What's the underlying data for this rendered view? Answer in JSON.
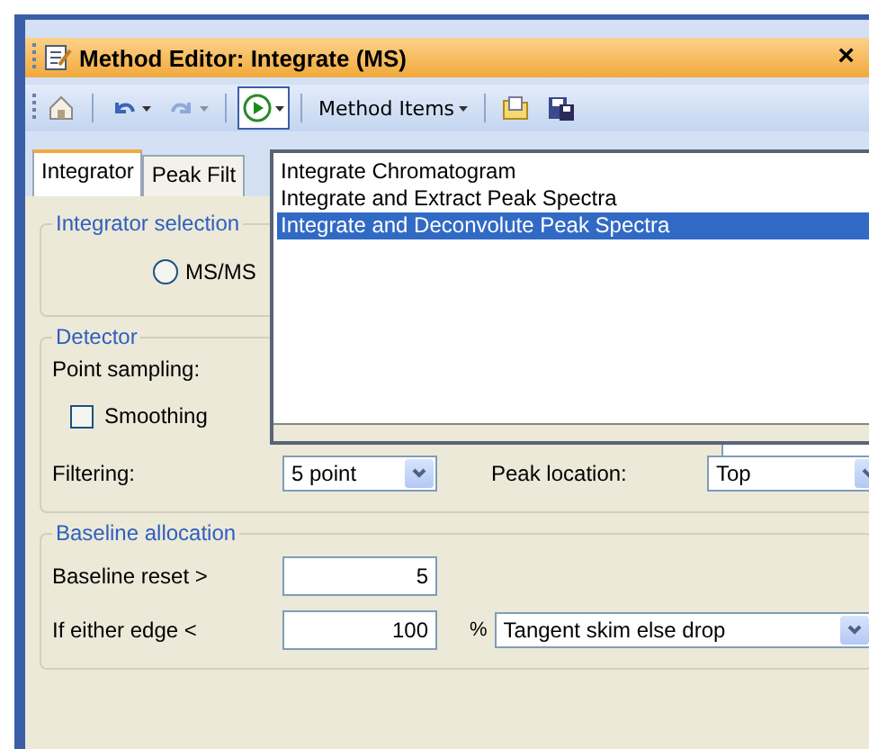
{
  "window": {
    "title": "Method Editor: Integrate (MS)",
    "close": "×"
  },
  "toolbar": {
    "items": [
      {
        "kind": "home",
        "disabled": false
      },
      {
        "kind": "separator"
      },
      {
        "kind": "undo",
        "disabled": false
      },
      {
        "kind": "redo",
        "disabled": true
      },
      {
        "kind": "separator"
      },
      {
        "kind": "run",
        "disabled": false,
        "pressed": true
      },
      {
        "kind": "separator"
      },
      {
        "kind": "menu",
        "label": "Method Items"
      },
      {
        "kind": "separator"
      },
      {
        "kind": "open",
        "disabled": false
      },
      {
        "kind": "save",
        "disabled": false
      }
    ]
  },
  "tabs": [
    {
      "label": "Integrator",
      "selected": true
    },
    {
      "label": "Peak Filt",
      "selected": false
    }
  ],
  "run_menu": {
    "items": [
      {
        "label": "Integrate Chromatogram",
        "selected": false
      },
      {
        "label": "Integrate and Extract Peak Spectra",
        "selected": false
      },
      {
        "label": "Integrate and Deconvolute Peak Spectra",
        "selected": true
      }
    ]
  },
  "integrator_selection": {
    "title": "Integrator selection",
    "options": [
      {
        "label": "MS/MS",
        "selected": false
      }
    ]
  },
  "detector": {
    "title": "Detector",
    "point_sampling_label": "Point sampling:",
    "smoothing": {
      "label": "Smoothing",
      "checked": false
    },
    "filtering": {
      "label": "Filtering:",
      "value": "5 point"
    },
    "peak_location": {
      "label": "Peak location:",
      "value": "Top"
    }
  },
  "baseline": {
    "title": "Baseline allocation",
    "reset": {
      "label": "Baseline reset >",
      "value": "5"
    },
    "edge": {
      "label": "If either edge <",
      "value": "100",
      "unit": "%",
      "mode": "Tangent skim else drop"
    }
  }
}
